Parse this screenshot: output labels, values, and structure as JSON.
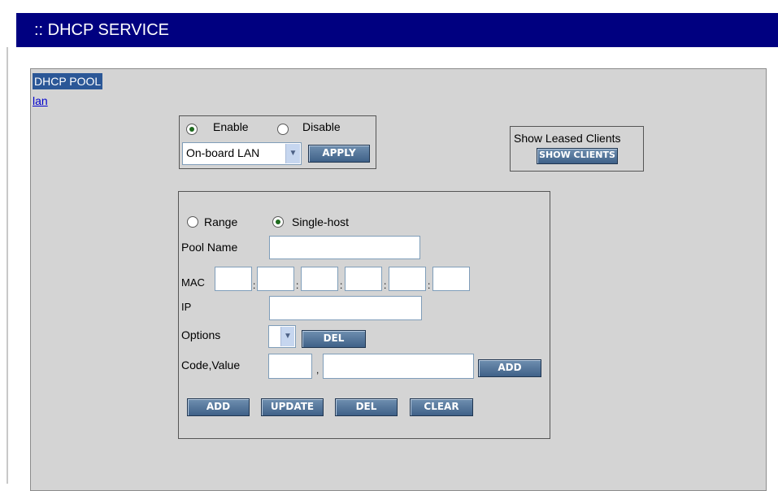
{
  "header": {
    "title": ":: DHCP SERVICE"
  },
  "pool": {
    "title": "DHCP POOL",
    "link": "lan"
  },
  "service": {
    "enable_label": "Enable",
    "disable_label": "Disable",
    "interface_value": "On-board LAN",
    "apply_label": "APPLY"
  },
  "leased": {
    "label": "Show Leased Clients",
    "button_label": "SHOW CLIENTS"
  },
  "form": {
    "range_label": "Range",
    "single_host_label": "Single-host",
    "pool_name_label": "Pool Name",
    "mac_label": "MAC",
    "ip_label": "IP",
    "options_label": "Options",
    "options_del_label": "DEL",
    "code_value_label": "Code,Value",
    "code_value_sep": ",",
    "code_add_label": "ADD",
    "mac_sep": ":"
  },
  "actions": {
    "add": "ADD",
    "update": "UPDATE",
    "del": "DEL",
    "clear": "CLEAR"
  }
}
